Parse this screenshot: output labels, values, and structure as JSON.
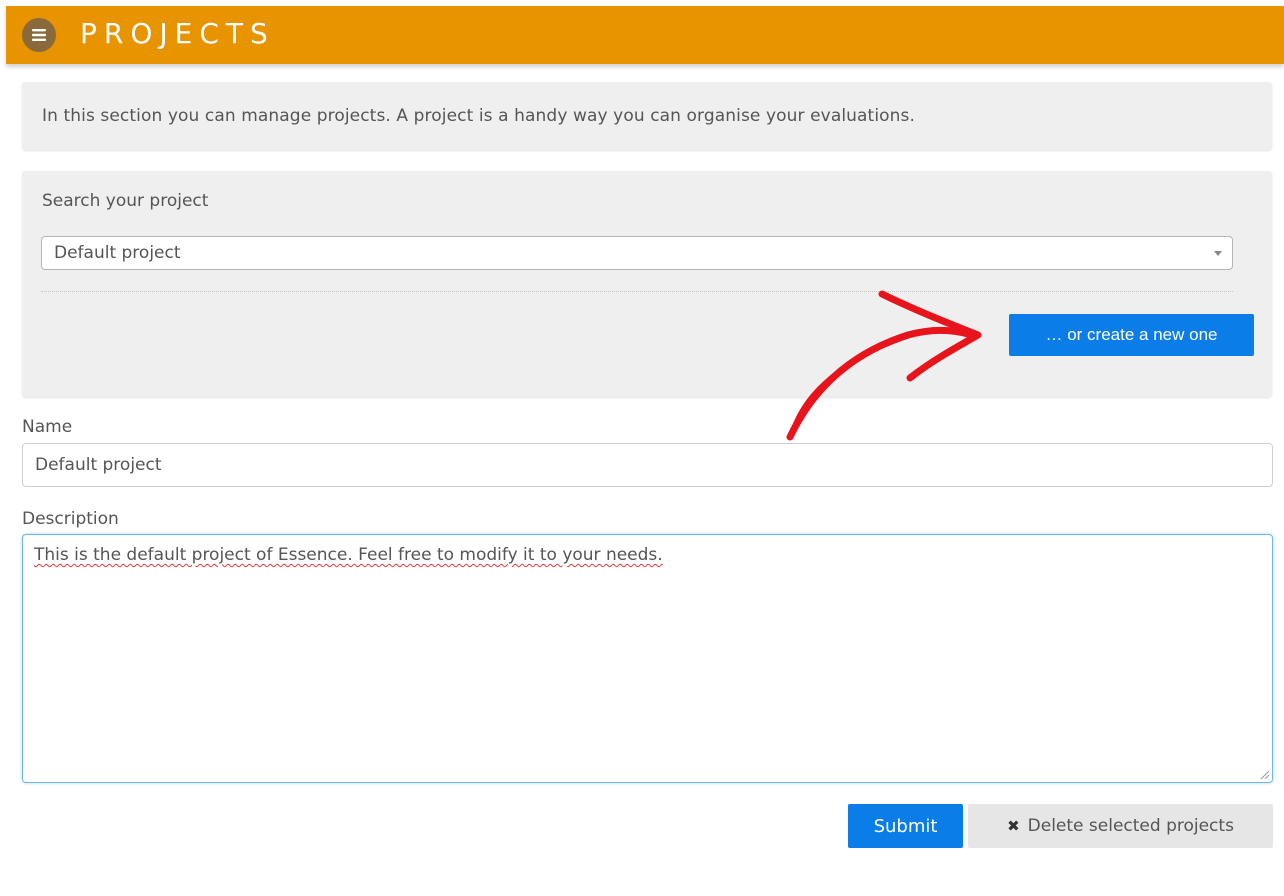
{
  "header": {
    "title": "PROJECTS",
    "menu_icon": "hamburger-menu-icon",
    "background_color": "#e89300"
  },
  "intro": {
    "text": "In this section you can manage projects. A project is a handy way you can organise your evaluations."
  },
  "search": {
    "label": "Search your project",
    "selected_value": "Default project",
    "create_button_label": "… or create a new one"
  },
  "form": {
    "name_label": "Name",
    "name_value": "Default project",
    "description_label": "Description",
    "description_value": "This is the default project of Essence. Feel free to modify it to your needs."
  },
  "actions": {
    "submit_label": "Submit",
    "delete_label": "Delete selected projects",
    "delete_icon": "close-icon"
  },
  "colors": {
    "accent_blue": "#0a7de8",
    "annotation_arrow": "#e8141c"
  }
}
